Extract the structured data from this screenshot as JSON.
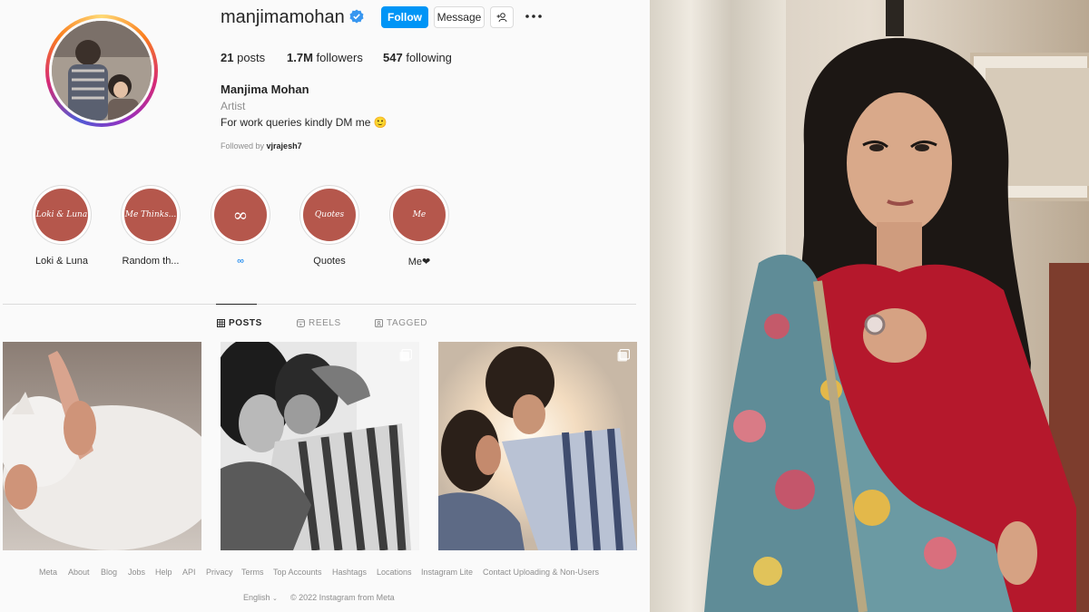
{
  "profile": {
    "username": "manjimamohan",
    "verified_icon": "verified-badge-icon",
    "follow_label": "Follow",
    "message_label": "Message",
    "posts_count": "21",
    "posts_label": "posts",
    "followers_count": "1.7M",
    "followers_label": "followers",
    "following_count": "547",
    "following_label": "following",
    "full_name": "Manjima Mohan",
    "category": "Artist",
    "bio": "For work queries kindly DM me 🙂",
    "followed_by_prefix": "Followed by",
    "followed_by_user": "vjrajesh7"
  },
  "highlights": [
    {
      "cover": "Loki & Luna",
      "label": "Loki & Luna"
    },
    {
      "cover": "Me Thinks...",
      "label": "Random th..."
    },
    {
      "cover": "∞",
      "label": "∞"
    },
    {
      "cover": "Quotes",
      "label": "Quotes"
    },
    {
      "cover": "Me",
      "label": "Me❤"
    }
  ],
  "tabs": [
    {
      "label": "POSTS",
      "icon": "grid-icon",
      "active": true
    },
    {
      "label": "REELS",
      "icon": "reels-icon",
      "active": false
    },
    {
      "label": "TAGGED",
      "icon": "tagged-icon",
      "active": false
    }
  ],
  "posts": [
    {
      "content": "white cat being petted",
      "multi": false
    },
    {
      "content": "black and white couple hugging",
      "multi": true
    },
    {
      "content": "couple nose to nose at sunset",
      "multi": true
    }
  ],
  "footer": {
    "links": [
      "Meta",
      "About",
      "Blog",
      "Jobs",
      "Help",
      "API",
      "Privacy",
      "Terms",
      "Top Accounts",
      "Hashtags",
      "Locations",
      "Instagram Lite",
      "Contact Uploading & Non-Users"
    ],
    "language": "English",
    "copyright": "© 2022 Instagram from Meta"
  },
  "colors": {
    "accent": "#0095f6",
    "highlight_cover": "#b5574c",
    "heart": "#ed4956"
  }
}
